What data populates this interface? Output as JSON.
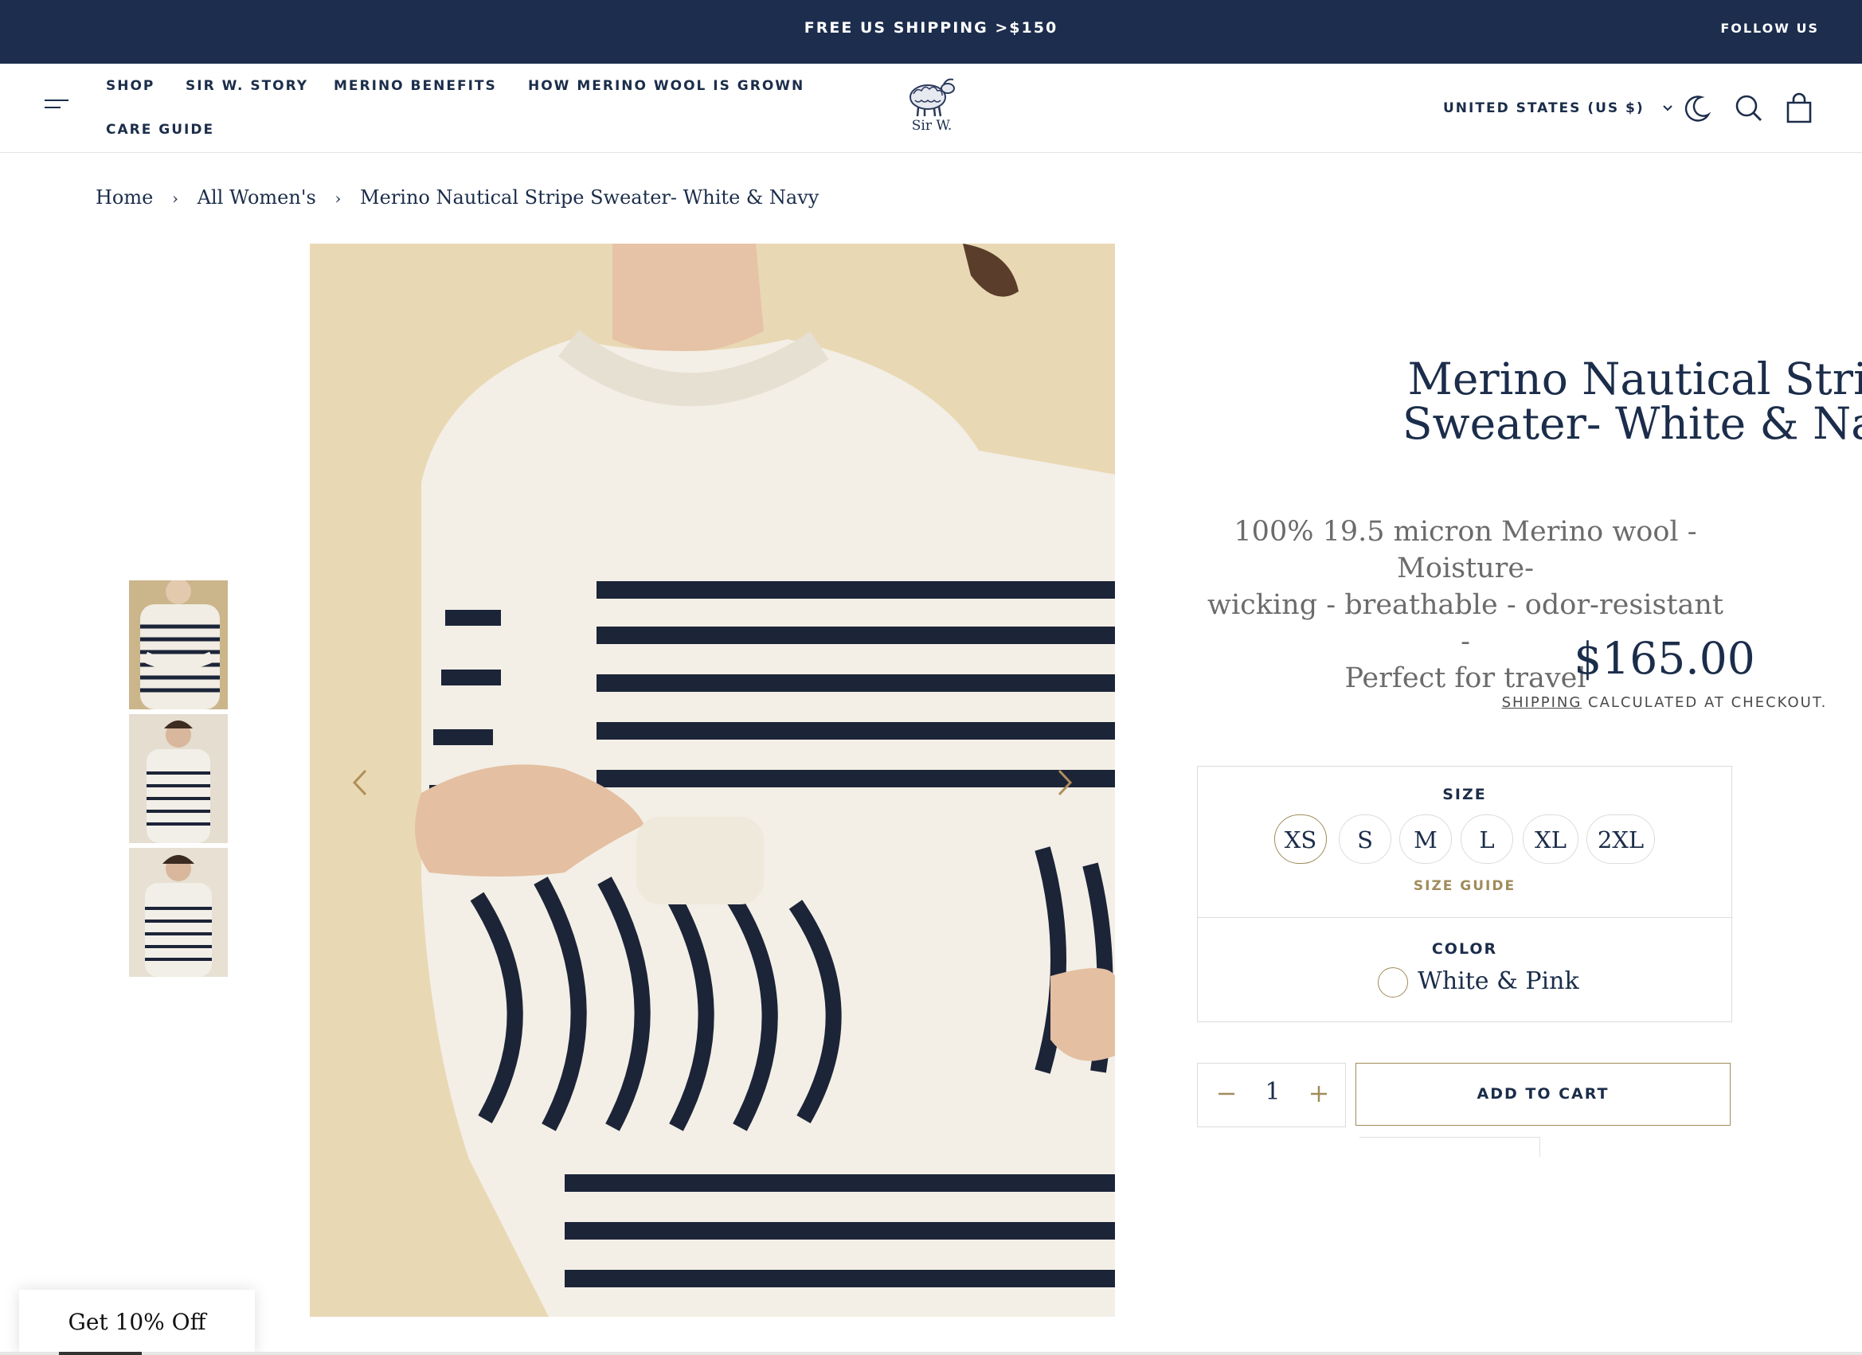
{
  "announcement": {
    "message": "FREE US SHIPPING >$150",
    "follow": "FOLLOW US"
  },
  "header": {
    "nav": [
      "SHOP",
      "SIR W. STORY",
      "MERINO BENEFITS",
      "HOW MERINO WOOL IS GROWN",
      "CARE GUIDE"
    ],
    "logo_text": "Sir W.",
    "country": "UNITED STATES (US $)",
    "icons": [
      "menu-icon",
      "moon-icon",
      "search-icon",
      "cart-icon",
      "chevron-down-icon"
    ]
  },
  "breadcrumb": {
    "items": [
      "Home",
      "All Women's",
      "Merino Nautical Stripe Sweater- White & Navy"
    ],
    "separator": "›"
  },
  "gallery": {
    "thumbnail_count": 3,
    "prev_icon": "chevron-left-icon",
    "next_icon": "chevron-right-icon"
  },
  "product": {
    "title_line1": "Merino Nautical Stripe",
    "title_line2": "Sweater- White & Navy",
    "description_line1": "100% 19.5 micron Merino wool - Moisture-",
    "description_line2": "wicking - breathable - odor-resistant -",
    "description_line3": "Perfect for travel",
    "price": "$165.00",
    "shipping_link": "SHIPPING",
    "shipping_rest": " CALCULATED AT CHECKOUT.",
    "size_label": "SIZE",
    "sizes": [
      "XS",
      "S",
      "M",
      "L",
      "XL",
      "2XL"
    ],
    "selected_size": "XS",
    "size_guide": "SIZE GUIDE",
    "color_label": "COLOR",
    "color_name": "White & Pink",
    "quantity": "1",
    "add_to_cart": "ADD TO CART"
  },
  "promo": {
    "label": "Get 10% Off"
  },
  "colors": {
    "navy": "#1c2d4d",
    "gold": "#a08c5b",
    "image_bg": "#e9d8b4"
  }
}
